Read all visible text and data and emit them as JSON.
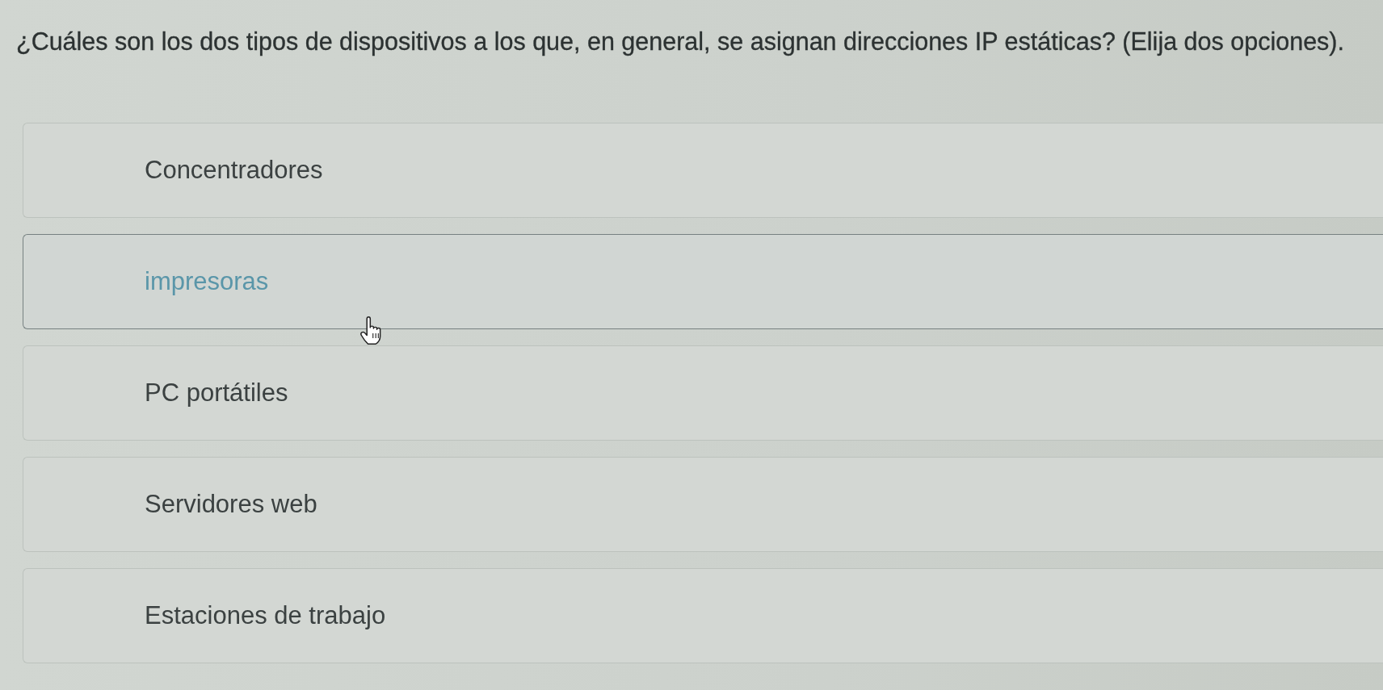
{
  "question": {
    "text": "¿Cuáles son los dos tipos de dispositivos a los que, en general, se asignan direcciones IP estáticas? (Elija dos opciones)."
  },
  "options": [
    {
      "label": "Concentradores",
      "hovered": false
    },
    {
      "label": "impresoras",
      "hovered": true
    },
    {
      "label": "PC portátiles",
      "hovered": false
    },
    {
      "label": "Servidores web",
      "hovered": false
    },
    {
      "label": "Estaciones de trabajo",
      "hovered": false
    }
  ]
}
